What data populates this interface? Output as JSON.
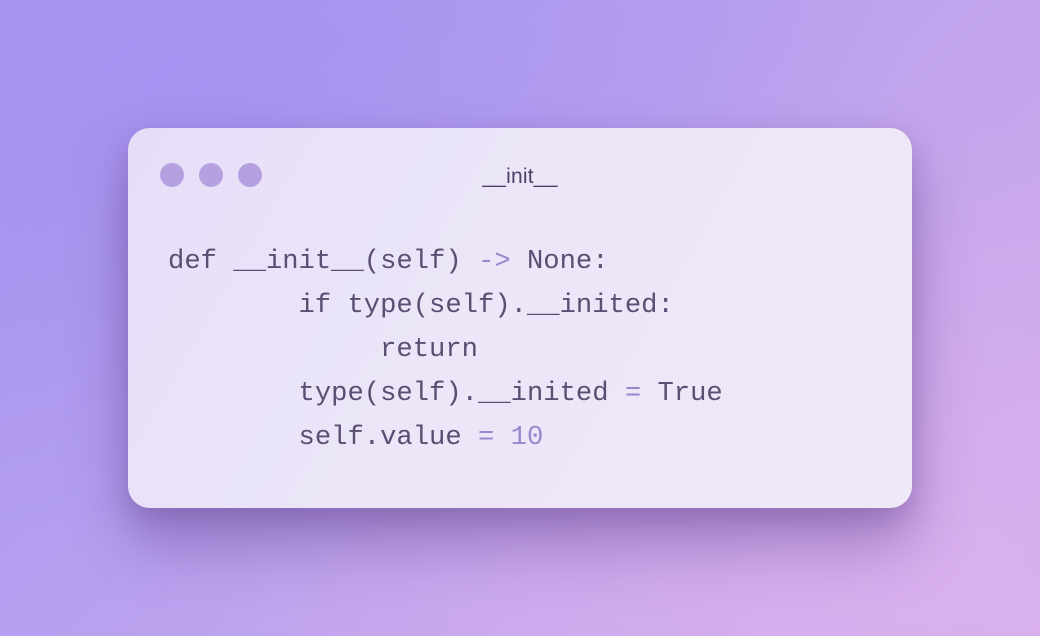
{
  "window": {
    "title": "__init__",
    "controls": [
      "window-dot-1",
      "window-dot-2",
      "window-dot-3"
    ],
    "dot_color": "#b5a0e0"
  },
  "code": {
    "language": "python",
    "lines": [
      {
        "indent": "",
        "parts": [
          "def __init__(self) ",
          "->",
          " None:"
        ]
      },
      {
        "indent": "        ",
        "parts": [
          "if type(self).__inited:"
        ]
      },
      {
        "indent": "             ",
        "parts": [
          "return"
        ]
      },
      {
        "indent": "        ",
        "parts": [
          "type(self).__inited ",
          "=",
          " True"
        ]
      },
      {
        "indent": "        ",
        "parts": [
          "self.value ",
          "=",
          " ",
          "10"
        ]
      }
    ]
  },
  "colors": {
    "text": "#5a4e72",
    "operator": "#9a86cc",
    "number": "#9a86cc",
    "background_start": "#a995ef",
    "background_end": "#d2aceb",
    "window_bg": "#ece6f8"
  }
}
